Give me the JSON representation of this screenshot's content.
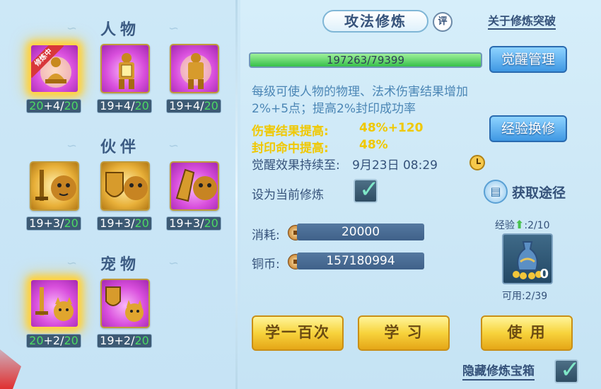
{
  "sections": {
    "character": "人物",
    "partner": "伙伴",
    "pet": "宠物"
  },
  "character_items": [
    {
      "icon": "meditating-warrior-icon",
      "prefix": "20",
      "mid": "+4/",
      "suffix": "20",
      "ribbon": "修炼中"
    },
    {
      "icon": "armored-warrior-shield-icon",
      "prefix": "",
      "mid": "19+4/",
      "suffix": "20"
    },
    {
      "icon": "armored-warrior-icon",
      "prefix": "",
      "mid": "19+4/",
      "suffix": "20"
    }
  ],
  "partner_items": [
    {
      "icon": "sword-tiger-icon",
      "prefix": "",
      "mid": "19+3/",
      "suffix": "20"
    },
    {
      "icon": "shield-tiger-icon",
      "prefix": "",
      "mid": "19+3/",
      "suffix": "20"
    },
    {
      "icon": "gauntlet-tiger-icon",
      "prefix": "",
      "mid": "19+3/",
      "suffix": "20"
    }
  ],
  "pet_items": [
    {
      "icon": "sword-cat-icon",
      "prefix": "20",
      "mid": "+2/",
      "suffix": "20"
    },
    {
      "icon": "shield-cat-icon",
      "prefix": "",
      "mid": "19+2/",
      "suffix": "20"
    }
  ],
  "header": {
    "title": "攻法修炼",
    "badge": "评",
    "about_link": "关于修炼突破"
  },
  "progress": {
    "text": "197263/79399",
    "fraction": 1.0
  },
  "buttons": {
    "awaken": "觉醒管理",
    "exchange": "经验换修",
    "learn100": "学一百次",
    "learn": "学 习",
    "use": "使 用"
  },
  "description": "每级可使人物的物理、法术伤害结果增加2%+5点；提高2%封印成功率",
  "stats": [
    {
      "label": "伤害结果提高:",
      "value": "48%+120"
    },
    {
      "label": "封印命中提高:",
      "value": "48%"
    }
  ],
  "awaken_duration": {
    "label": "觉醒效果持续至:",
    "value": "9月23日 08:29"
  },
  "set_current": {
    "label": "设为当前修炼",
    "checked": true
  },
  "gain_path": "获取途径",
  "cost": {
    "label": "消耗:",
    "value": "20000"
  },
  "copper": {
    "label": "铜币:",
    "value": "157180994"
  },
  "exp": {
    "label": "经验",
    "value": ":2/10"
  },
  "vase": {
    "icon": "vase-coins-icon",
    "count": "0"
  },
  "available": "可用:2/39",
  "hide_chest": {
    "label": "隐藏修炼宝箱",
    "checked": true
  },
  "colors": {
    "accent_blue": "#3f98e3",
    "accent_yellow": "#f7d33c",
    "stat_yellow": "#f0c800",
    "level_green": "#4cd963"
  }
}
